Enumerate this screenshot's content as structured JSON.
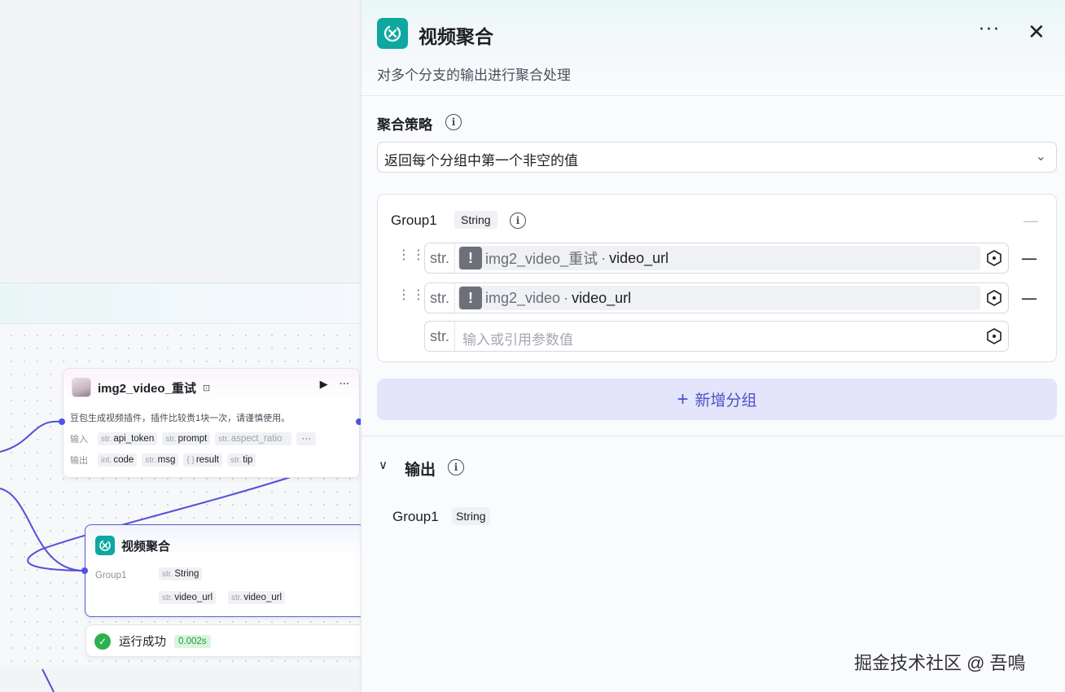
{
  "canvas": {
    "img2_node": {
      "title": "img2_video_重试",
      "description": "豆包生成视频插件，插件比较贵1块一次，请谨慎使用。",
      "input_label": "输入",
      "output_label": "输出",
      "inputs": [
        {
          "type": "str.",
          "name": "api_token"
        },
        {
          "type": "str.",
          "name": "prompt"
        },
        {
          "type": "str.",
          "name": "aspect_ratio"
        }
      ],
      "more": "···",
      "outputs": [
        {
          "type": "int.",
          "name": "code"
        },
        {
          "type": "str.",
          "name": "msg"
        },
        {
          "type": "{ }",
          "name": "result"
        },
        {
          "type": "str.",
          "name": "tip"
        }
      ]
    },
    "agg_node": {
      "title": "视频聚合",
      "group_label": "Group1",
      "group_type": {
        "type": "str.",
        "name": "String"
      },
      "vars": [
        {
          "type": "str.",
          "name": "video_url"
        },
        {
          "type": "str.",
          "name": "video_url"
        }
      ]
    },
    "status": {
      "text": "运行成功",
      "time": "0.002s"
    }
  },
  "panel": {
    "title": "视频聚合",
    "description": "对多个分支的输出进行聚合处理",
    "strategy": {
      "label": "聚合策略",
      "value": "返回每个分组中第一个非空的值"
    },
    "group": {
      "name": "Group1",
      "type": "String",
      "vars": [
        {
          "prefix": "str.",
          "node": "img2_video_重试",
          "dot": "·",
          "field": "video_url"
        },
        {
          "prefix": "str.",
          "node": "img2_video",
          "dot": "·",
          "field": "video_url"
        }
      ],
      "new_var": {
        "prefix": "str.",
        "placeholder": "输入或引用参数值"
      }
    },
    "add_group_label": "新增分组",
    "output": {
      "label": "输出",
      "name": "Group1",
      "type": "String"
    }
  },
  "watermark": "掘金技术社区 @ 吾鳴",
  "colors": {
    "accent": "#4d53e8",
    "brand_teal": "#0fa8a0",
    "success": "#2bb24c"
  }
}
